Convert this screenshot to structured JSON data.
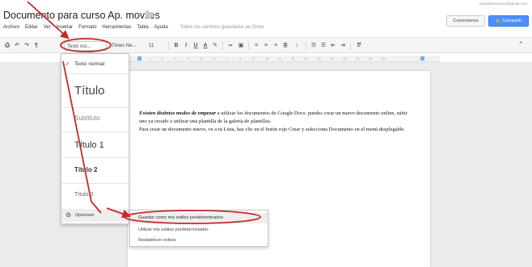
{
  "header": {
    "doc_title": "Documento para curso Ap. moviles",
    "user_email": "estudiantecursos@gmail.com",
    "comments_label": "Comentarios",
    "share_label": "Compartir"
  },
  "menubar": {
    "items": [
      "Archivo",
      "Editar",
      "Ver",
      "Insertar",
      "Formato",
      "Herramientas",
      "Tabla",
      "Ayuda"
    ],
    "saved_status": "Todos los cambios guardados en Drive"
  },
  "toolbar": {
    "style_value": "Texto nor...",
    "font_value": "Times Ne...",
    "size_value": "11"
  },
  "ruler": {
    "marks": [
      "1",
      "2",
      "3",
      "4",
      "5",
      "6",
      "7",
      "8",
      "9",
      "10",
      "11",
      "12",
      "13",
      "14",
      "15",
      "16",
      "17",
      "18",
      "19"
    ]
  },
  "style_menu": {
    "items": [
      {
        "label": "Texto normal",
        "checked": true
      },
      {
        "label": "Título"
      },
      {
        "label": "Subtítulo"
      },
      {
        "label": "Título 1"
      },
      {
        "label": "Título 2"
      },
      {
        "label": "Título 3"
      }
    ],
    "options_label": "Opciones"
  },
  "options_menu": {
    "items": [
      "Guardar como mis estilos predeterminados",
      "Utilizar mis estilos predeterminados",
      "Restablecer estilos"
    ]
  },
  "document": {
    "para1_lead": "Existen distintos modos de empezar",
    "para1_rest": " a utilizar los documentos de Google Docs: puedes crear un nuevo documento online, subir uno ya creado o utilizar una plantilla de la galería de plantillas.",
    "para2": "Para crear un documento nuevo, ve a tu Lista, haz clic en el botón rojo Crear y selecciona Documento en el menú desplegable."
  },
  "colors": {
    "share_blue": "#4d90fe",
    "annotation_red": "#c62828"
  },
  "icons": [
    "star-icon",
    "folder-icon",
    "print-icon",
    "undo-icon",
    "redo-icon",
    "paint-format-icon",
    "gear-icon",
    "chevron-right-icon",
    "checkmark-icon",
    "collapse-icon"
  ]
}
